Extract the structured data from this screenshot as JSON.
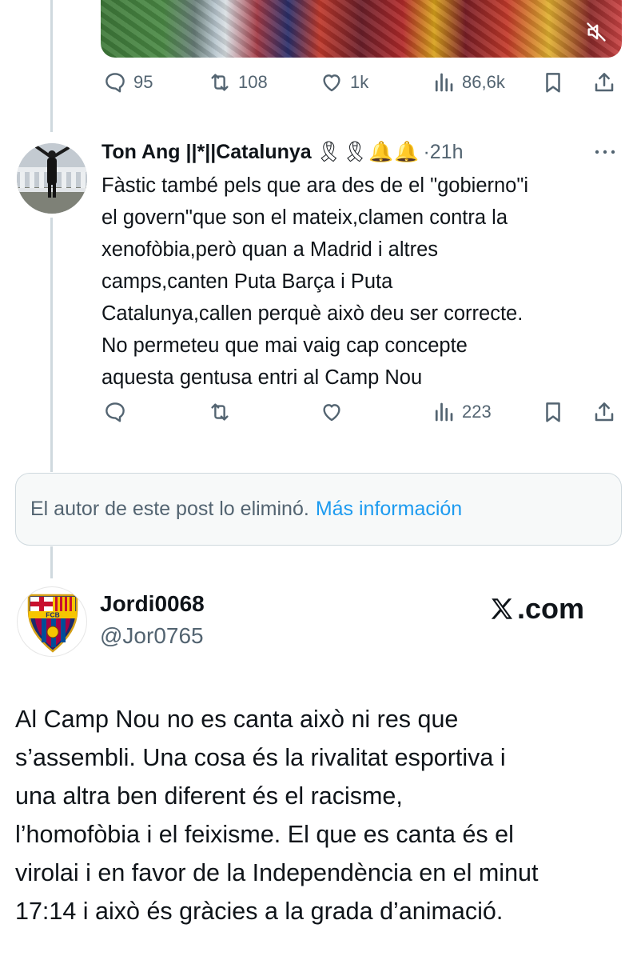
{
  "top_post": {
    "stats": {
      "replies": "95",
      "reposts": "108",
      "likes": "1k",
      "views": "86,6k"
    }
  },
  "reply": {
    "author_name": "Ton Ang ||*||Catalunya",
    "author_emojis": "🎗🎗🔔🔔",
    "separator": "·",
    "time": "21h",
    "text": "Fàstic també pels que ara des de el \"gobierno\"i\nel govern\"que son el mateix,clamen contra la\nxenofòbia,però quan a Madrid i altres\ncamps,canten Puta Barça i Puta\nCatalunya,callen perquè això deu ser correcte.\nNo permeteu que mai vaig cap concepte\naquesta gentusa entri al Camp Nou",
    "stats": {
      "views": "223"
    }
  },
  "deleted_notice": {
    "text": "El autor de este post lo eliminó.",
    "link": "Más información"
  },
  "quoted": {
    "name": "Jordi0068",
    "handle": "@Jor0765",
    "avatar_text": "FCB",
    "watermark": ".com",
    "text": "Al Camp Nou no es canta això ni res que\ns’assembli. Una cosa és la rivalitat esportiva i\nuna altra ben diferent és el racisme,\nl’homofòbia i el feixisme. El que es canta és el\nvirolai i en favor de la Independència en el minut\n17:14 i això és gràcies a la grada d’animació."
  },
  "colors": {
    "text": "#0f1419",
    "secondary": "#536471",
    "link": "#1d9bf0",
    "border": "#cfd9de"
  }
}
